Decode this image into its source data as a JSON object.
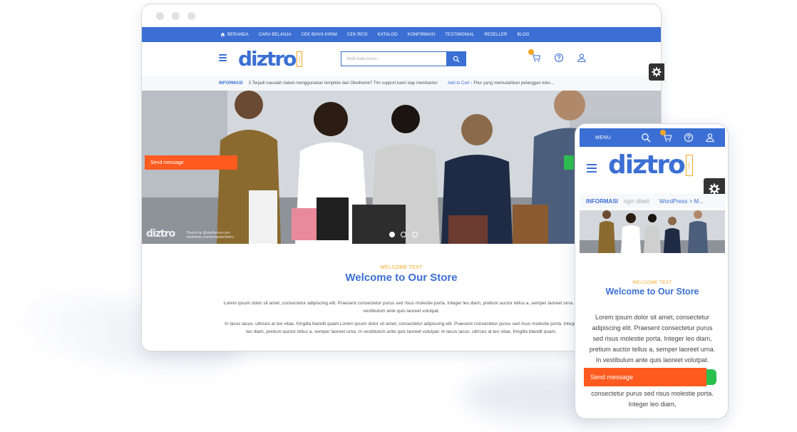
{
  "desktop": {
    "topnav": [
      "BERANDA",
      "CARA BELANJA",
      "CEK BIAYA KIRIM",
      "CEK RESI",
      "KATALOG",
      "KONFIRMASI",
      "TESTIMONIAL",
      "RESELLER",
      "BLOG"
    ],
    "logo": "diztro",
    "logo_badge": "store",
    "search_placeholder": "ketik kata kunci...",
    "info": {
      "label": "INFORMASI",
      "text": "3 Terjadi masalah dalam menggunakan templete dari Oketheme? Tim support kami siap membantu!",
      "link": "Add to Cart",
      "link_text": "Fitur yang memudahkan pelanggan toko..."
    },
    "hero": {
      "watermark": "diztro",
      "credit_line1": "Theme by @oketheme.com",
      "credit_line2": "oketheme.com/template/diztro",
      "slides": 3,
      "active_slide": 1
    },
    "send_message": "Send message",
    "welcome_small": "WELCOME TEXT",
    "welcome_title": "Welcome to Our Store",
    "para1": "Lorem ipsum dolor sit amet, consectetur adipiscing elit. Praesent consectetur purus sed risus molestie porta. Integer leo diam, pretium auctor tellus a, semper laoreet urna. In vestibulum ante quis laoreet volutpat.",
    "para2": "In lacus lacus, ultrices at leo vitae, fringilla blandit quam.Lorem ipsum dolor sit amet, consectetur adipiscing elit. Praesent consectetur purus sed risus molestie porta. Integer leo diam, pretium auctor tellus a, semper laoreet urna. In vestibulum ante quis laoreet volutpat. In lacus lacus, ultrices at leo vitae, fringilla blandit quam."
  },
  "mobile": {
    "menu_label": "MENU",
    "cart_count": "0",
    "logo": "diztro",
    "logo_badge": "store",
    "info": {
      "label": "INFORMASI",
      "text": "ngin dibeli",
      "link": "WordPress > M..."
    },
    "welcome_small": "WELCOME TEXT",
    "welcome_title": "Welcome to Our Store",
    "para1": "Lorem ipsum dolor sit amet, consectetur adipiscing elit. Praesent consectetur purus sed risus molestie porta. Integer leo diam, pretium auctor tellus a, semper laoreet urna. In vestibulum ante quis laoreet volutpat.",
    "para2": "blandit quam.Lorem ipsum dolor sit amet, consectetur adipiscing elit. Praesent consectetur purus sed risus molestie porta. Integer leo diam,",
    "send_message": "Send message"
  },
  "colors": {
    "primary": "#3b6fd4",
    "accent": "#f5a623",
    "cta": "#ff5a1f",
    "whatsapp": "#2bbf4e"
  }
}
